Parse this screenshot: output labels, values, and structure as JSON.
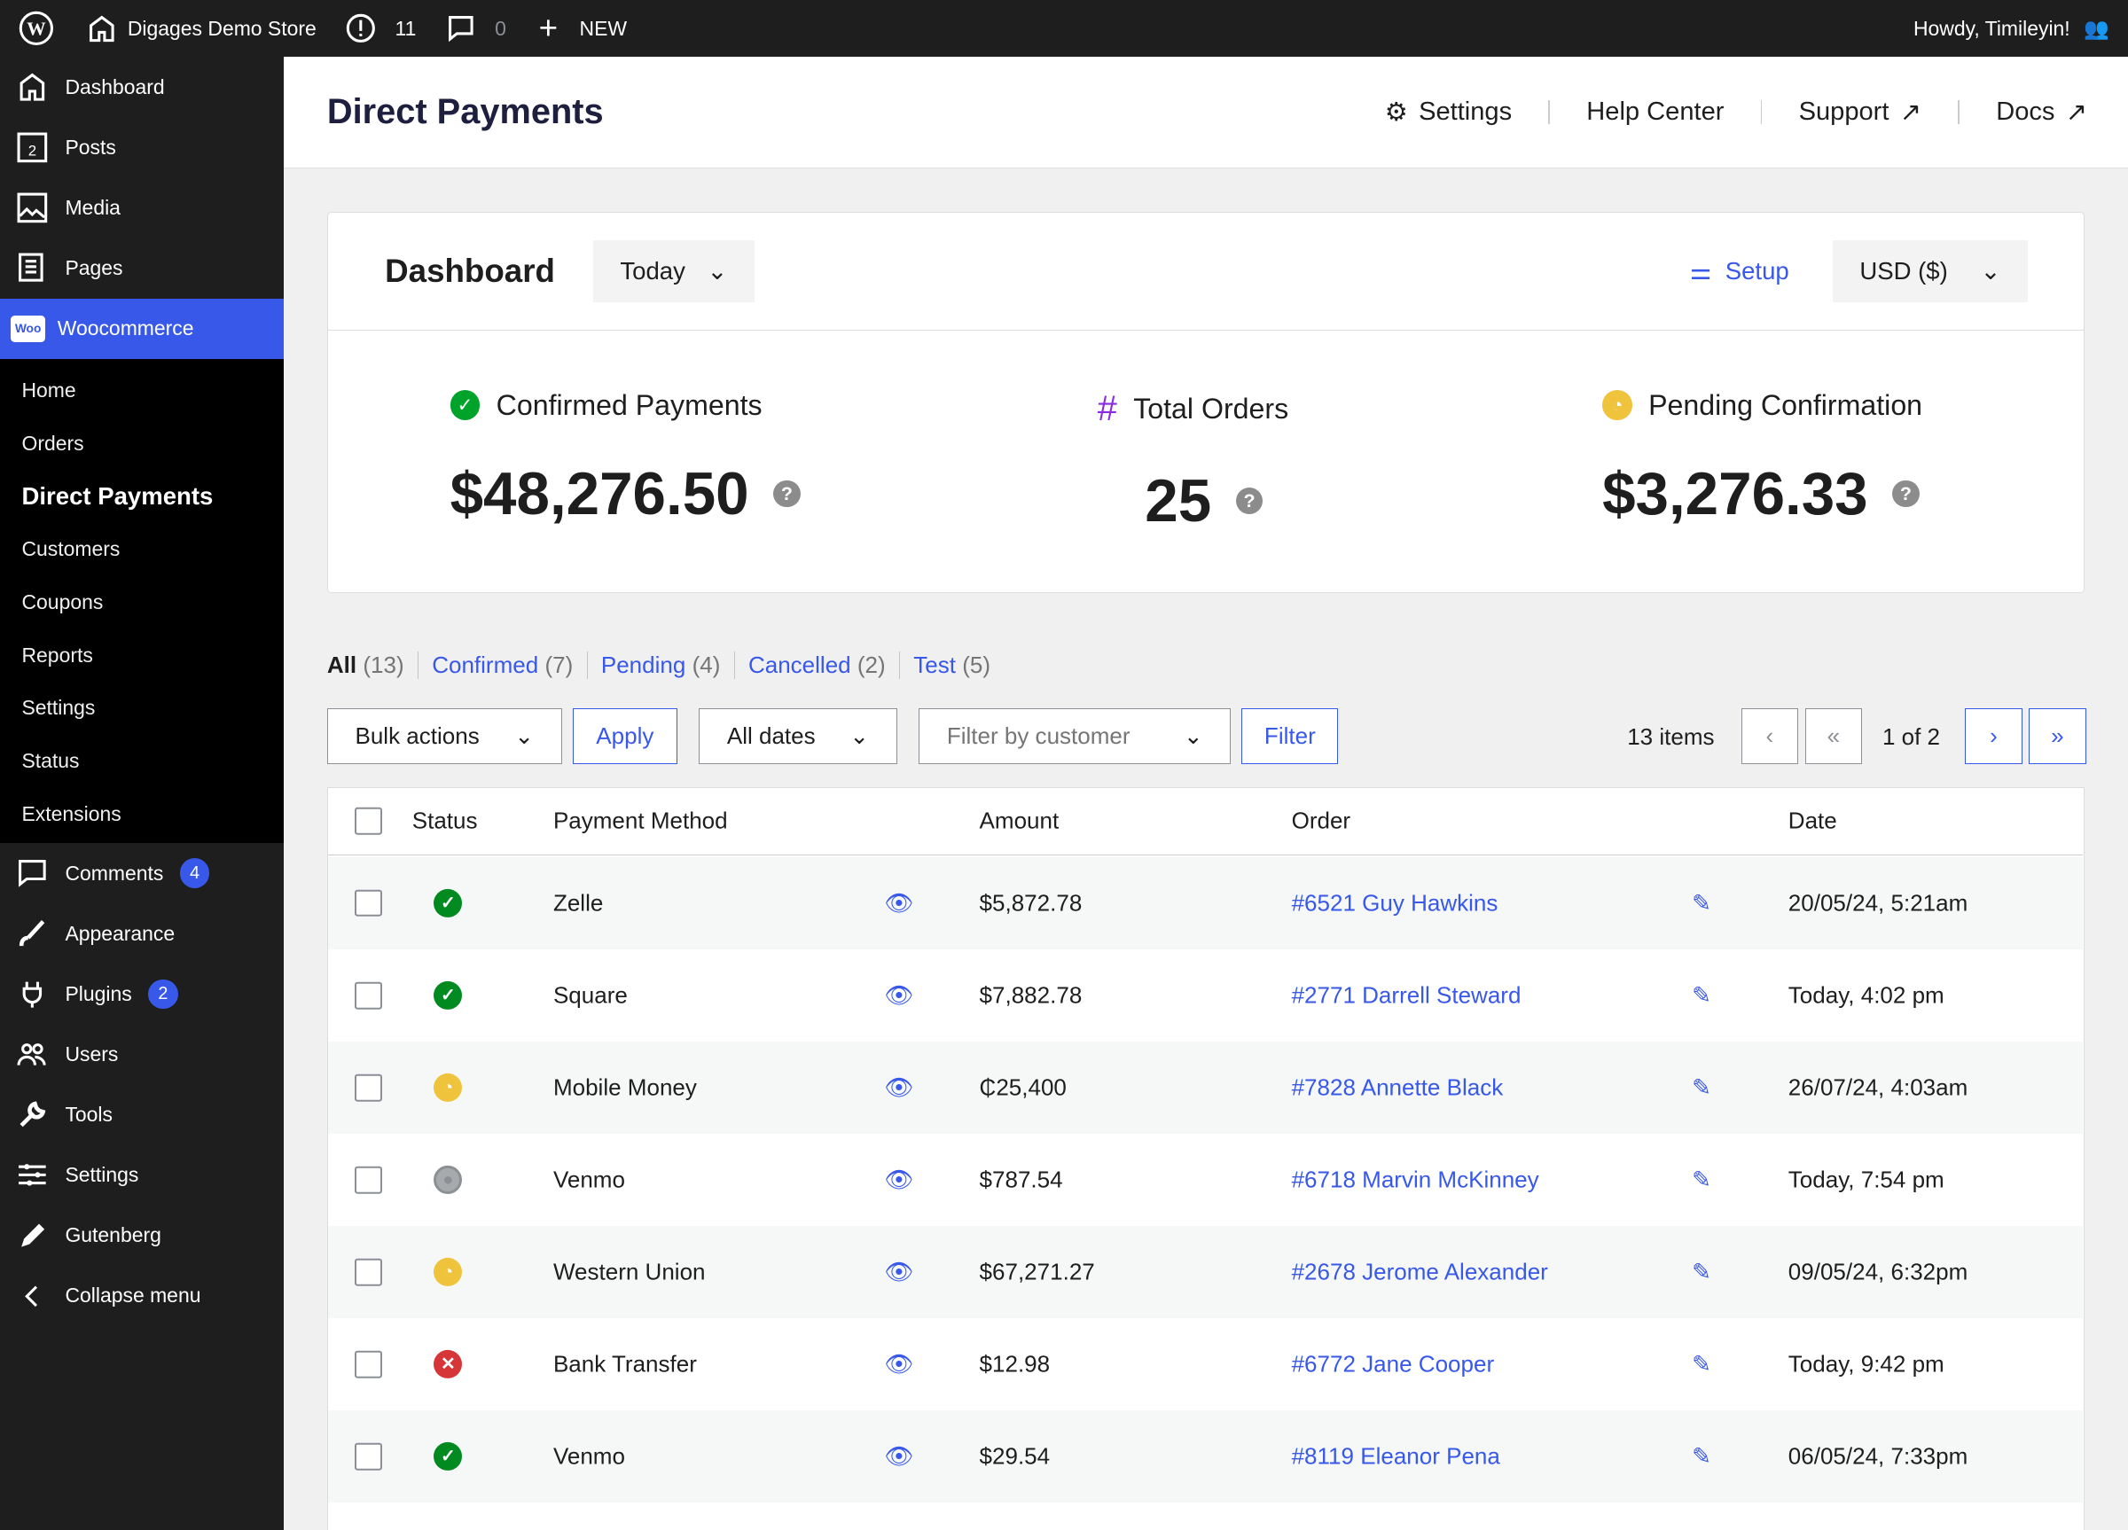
{
  "topbar": {
    "site": "Digages Demo Store",
    "updates": "11",
    "comments": "0",
    "new": "NEW",
    "greeting": "Howdy, Timileyin!"
  },
  "sidebar": {
    "items": [
      {
        "label": "Dashboard"
      },
      {
        "label": "Posts"
      },
      {
        "label": "Media"
      },
      {
        "label": "Pages"
      },
      {
        "label": "Woocommerce"
      },
      {
        "label": "Comments",
        "badge": "4"
      },
      {
        "label": "Appearance"
      },
      {
        "label": "Plugins",
        "badge": "2"
      },
      {
        "label": "Users"
      },
      {
        "label": "Tools"
      },
      {
        "label": "Settings"
      },
      {
        "label": "Gutenberg"
      },
      {
        "label": "Collapse menu"
      }
    ],
    "submenu": [
      "Home",
      "Orders",
      "Direct Payments",
      "Customers",
      "Coupons",
      "Reports",
      "Settings",
      "Status",
      "Extensions"
    ]
  },
  "header": {
    "title": "Direct Payments",
    "nav": [
      "Settings",
      "Help Center",
      "Support",
      "Docs"
    ]
  },
  "dashboard": {
    "title": "Dashboard",
    "period": "Today",
    "setup": "Setup",
    "currency": "USD ($)",
    "stats": [
      {
        "label": "Confirmed Payments",
        "value": "$48,276.50",
        "color": "#00a32a"
      },
      {
        "label": "Total Orders",
        "value": "25",
        "color": "#8a2be2"
      },
      {
        "label": "Pending Confirmation",
        "value": "$3,276.33",
        "color": "#f0c33c"
      }
    ]
  },
  "filters": {
    "tabs": [
      {
        "label": "All",
        "count": "(13)"
      },
      {
        "label": "Confirmed",
        "count": "(7)"
      },
      {
        "label": "Pending",
        "count": "(4)"
      },
      {
        "label": "Cancelled",
        "count": "(2)"
      },
      {
        "label": "Test",
        "count": "(5)"
      }
    ]
  },
  "toolbar": {
    "bulk": "Bulk actions",
    "apply": "Apply",
    "dates": "All dates",
    "customer_placeholder": "Filter by customer",
    "filter": "Filter",
    "items": "13 items",
    "page": "1 of 2"
  },
  "table": {
    "columns": [
      "Status",
      "Payment Method",
      "Amount",
      "Order",
      "Date"
    ],
    "rows": [
      {
        "status": "confirmed",
        "method": "Zelle",
        "amount": "$5,872.78",
        "order": "#6521 Guy Hawkins",
        "date": "20/05/24, 5:21am"
      },
      {
        "status": "confirmed",
        "method": "Square",
        "amount": "$7,882.78",
        "order": "#2771 Darrell Steward",
        "date": "Today, 4:02 pm"
      },
      {
        "status": "pending",
        "method": "Mobile Money",
        "amount": "₵25,400",
        "order": "#7828 Annette Black",
        "date": "26/07/24, 4:03am"
      },
      {
        "status": "test",
        "method": "Venmo",
        "amount": "$787.54",
        "order": "#6718 Marvin McKinney",
        "date": "Today, 7:54 pm"
      },
      {
        "status": "pending",
        "method": "Western Union",
        "amount": "$67,271.27",
        "order": "#2678 Jerome Alexander",
        "date": "09/05/24, 6:32pm"
      },
      {
        "status": "cancelled",
        "method": "Bank Transfer",
        "amount": "$12.98",
        "order": "#6772 Jane Cooper",
        "date": "Today, 9:42 pm"
      },
      {
        "status": "confirmed",
        "method": "Venmo",
        "amount": "$29.54",
        "order": "#8119 Eleanor Pena",
        "date": "06/05/24, 7:33pm"
      }
    ]
  },
  "colors": {
    "accent": "#3858e9",
    "confirmed": "#008a20",
    "pending": "#f0c33c",
    "cancelled": "#d63638",
    "test": "#a7aaad"
  }
}
